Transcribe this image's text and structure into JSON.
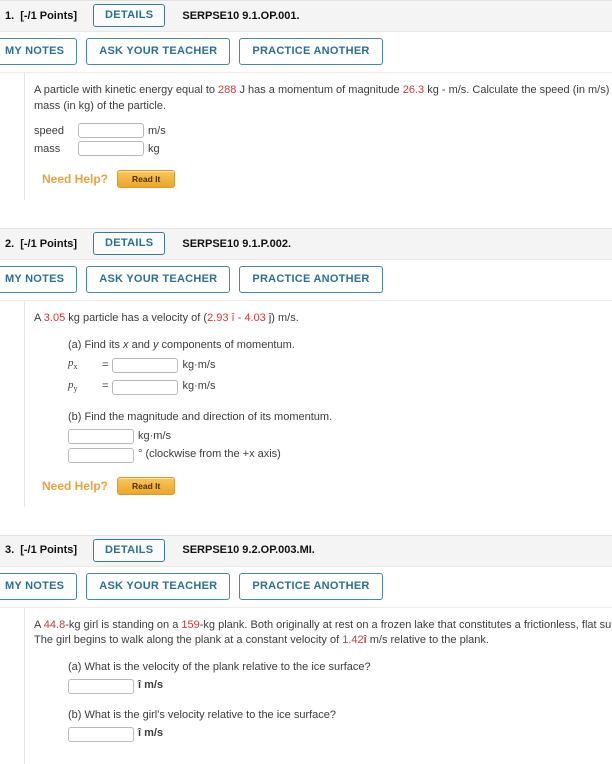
{
  "labels": {
    "details": "DETAILS",
    "my_notes": "MY NOTES",
    "ask_teacher": "ASK YOUR TEACHER",
    "practice_another": "PRACTICE ANOTHER",
    "need_help": "Need Help?",
    "read_it": "Read It",
    "points": "[-/1 Points]"
  },
  "colors": {
    "accent_blue": "#2e6f8e",
    "number_red": "#cf3a3a",
    "help_orange": "#e8a33d",
    "readit_gold": "#eda52a",
    "header_gray": "#f4f4f4"
  },
  "questions": [
    {
      "number": "1.",
      "points": "[-/1 Points]",
      "code": "SERPSE10 9.1.OP.001.",
      "prompt_line1_a": "A particle with kinetic energy equal to ",
      "prompt_num1": "288",
      "prompt_line1_b": " J has a momentum of magnitude ",
      "prompt_num2": "26.3",
      "prompt_line1_c": " kg - m/s. Calculate the speed (in m/s) and the",
      "prompt_line2": "mass (in kg) of the particle.",
      "answers": [
        {
          "label": "speed",
          "value": "",
          "unit": "m/s"
        },
        {
          "label": "mass",
          "value": "",
          "unit": "kg"
        }
      ]
    },
    {
      "number": "2.",
      "points": "[-/1 Points]",
      "code": "SERPSE10 9.1.P.002.",
      "prompt_a": "A ",
      "prompt_num1": "3.05",
      "prompt_b": " kg particle has a velocity of (",
      "prompt_num2": "2.93",
      "prompt_c": " î - ",
      "prompt_num3": "4.03",
      "prompt_d": " ĵ) m/s.",
      "part_a_text": "(a) Find its x and y components of momentum.",
      "part_a_rows": [
        {
          "symbol": "px",
          "value": "",
          "unit": "kg·m/s"
        },
        {
          "symbol": "py",
          "value": "",
          "unit": "kg·m/s"
        }
      ],
      "part_b_text": "(b) Find the magnitude and direction of its momentum.",
      "part_b_rows": [
        {
          "value": "",
          "unit": "kg·m/s"
        },
        {
          "value": "",
          "unit": "° (clockwise from the +x axis)"
        }
      ]
    },
    {
      "number": "3.",
      "points": "[-/1 Points]",
      "code": "SERPSE10 9.2.OP.003.MI.",
      "prompt_a": "A ",
      "prompt_num1": "44.8",
      "prompt_b": "-kg girl is standing on a ",
      "prompt_num2": "159",
      "prompt_c": "-kg plank. Both originally at rest on a frozen lake that constitutes a frictionless, flat surface.",
      "prompt_line2_a": "The girl begins to walk along the plank at a constant velocity of ",
      "prompt_num3": "1.42",
      "prompt_vec": "î",
      "prompt_line2_b": " m/s relative to the plank.",
      "part_a_text": "(a) What is the velocity of the plank relative to the ice surface?",
      "part_a_value": "",
      "part_a_unit": "î m/s",
      "part_b_text": "(b) What is the girl's velocity relative to the ice surface?",
      "part_b_value": "",
      "part_b_unit": "î m/s"
    }
  ]
}
